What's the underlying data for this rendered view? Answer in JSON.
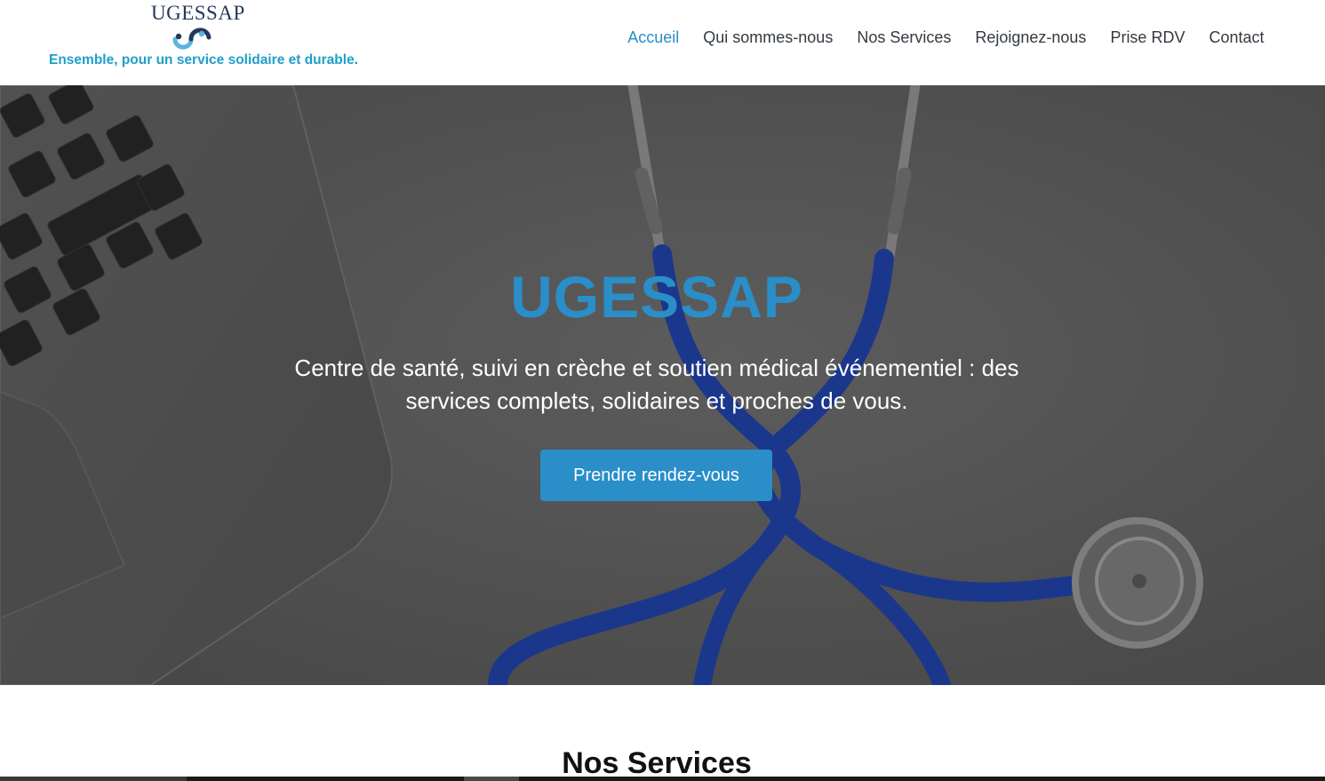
{
  "header": {
    "brand_name": "UGESSAP",
    "tagline": "Ensemble, pour un service solidaire et durable.",
    "logo_icon": "ugessap-logo-icon",
    "nav": [
      {
        "label": "Accueil",
        "active": true
      },
      {
        "label": "Qui sommes-nous",
        "active": false
      },
      {
        "label": "Nos Services",
        "active": false
      },
      {
        "label": "Rejoignez-nous",
        "active": false
      },
      {
        "label": "Prise RDV",
        "active": false
      },
      {
        "label": "Contact",
        "active": false
      }
    ]
  },
  "hero": {
    "title": "UGESSAP",
    "subtitle": "Centre de santé, suivi en crèche et soutien médical événementiel : des services complets, solidaires et proches de vous.",
    "cta_label": "Prendre rendez-vous",
    "background": "laptop-stethoscope-photo"
  },
  "services": {
    "heading": "Nos Services"
  },
  "colors": {
    "accent": "#2a8ec9",
    "tagline": "#1e9fc9",
    "brand_text": "#24385b",
    "nav_text": "#333a40"
  }
}
